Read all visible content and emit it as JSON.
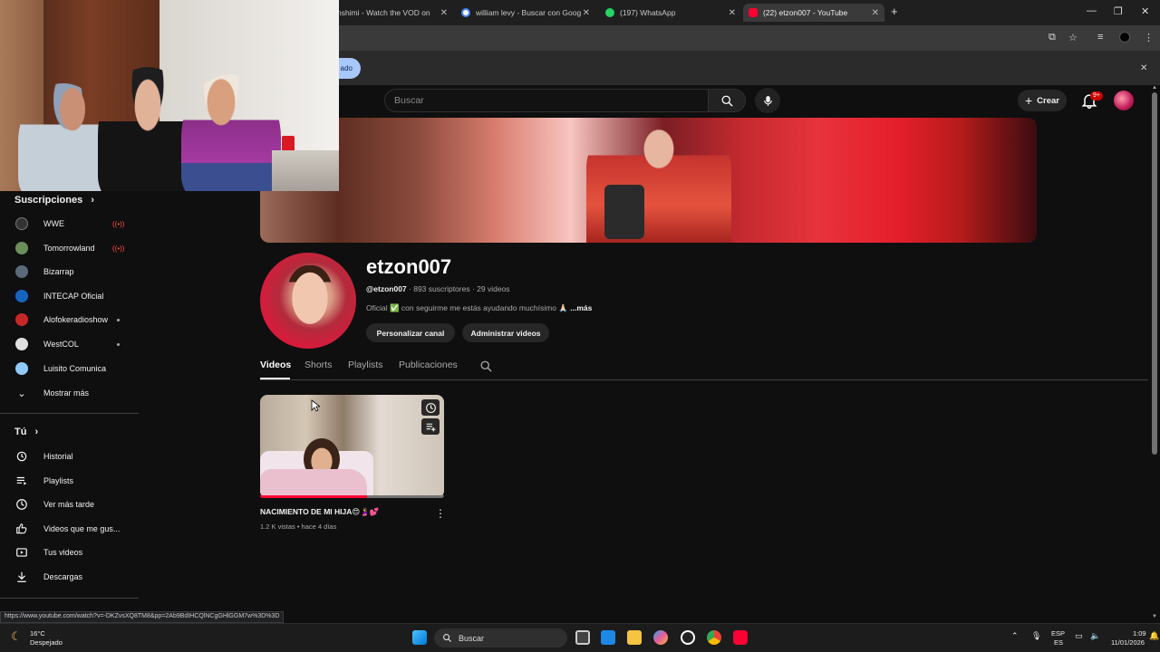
{
  "browser": {
    "tabs": [
      {
        "title": "nshimi - Watch the VOD on",
        "fav_color": "#ff7a00"
      },
      {
        "title": "william levy - Buscar con Goog",
        "fav_color": "#ffffff"
      },
      {
        "title": "(197) WhatsApp",
        "fav_color": "#25d366"
      },
      {
        "title": "(22) etzon007 - YouTube",
        "fav_color": "#ff0033"
      }
    ],
    "new_tab": "+",
    "infobar_partial": "ado",
    "close": "✕"
  },
  "header": {
    "search_placeholder": "Buscar",
    "create_label": "Crear",
    "notif_count": "9+"
  },
  "sidebar": {
    "subscriptions_title": "Suscripciones",
    "subscriptions": [
      {
        "label": "WWE",
        "status": "live",
        "color": "#333333"
      },
      {
        "label": "Tomorrowland",
        "status": "live",
        "color": "#6b8e5a"
      },
      {
        "label": "Bizarrap",
        "status": "",
        "color": "#5a6a7a"
      },
      {
        "label": "INTECAP Oficial",
        "status": "",
        "color": "#1565c0"
      },
      {
        "label": "Alofokeradioshow",
        "status": "dot",
        "color": "#c62828"
      },
      {
        "label": "WestCOL",
        "status": "dot",
        "color": "#e0e0e0"
      },
      {
        "label": "Luisito Comunica",
        "status": "",
        "color": "#90caf9"
      }
    ],
    "show_more": "Mostrar más",
    "you_title": "Tú",
    "you_items": [
      {
        "label": "Historial",
        "icon": "history-icon"
      },
      {
        "label": "Playlists",
        "icon": "playlists-icon"
      },
      {
        "label": "Ver más tarde",
        "icon": "watch-later-icon"
      },
      {
        "label": "Videos que me gus...",
        "icon": "like-icon"
      },
      {
        "label": "Tus videos",
        "icon": "your-videos-icon"
      },
      {
        "label": "Descargas",
        "icon": "download-icon"
      }
    ]
  },
  "channel": {
    "name": "etzon007",
    "handle": "@etzon007",
    "stats": " · 893 suscriptores · 29 videos",
    "desc": "Oficial ✅ con seguirme me estás ayudando muchísimo 🙏🏻",
    "more": " ...más",
    "customize_btn": "Personalizar canal",
    "manage_btn": "Administrar videos",
    "tabs": [
      "Videos",
      "Shorts",
      "Playlists",
      "Publicaciones"
    ]
  },
  "video": {
    "title": "NACIMIENTO DE MI HIJA😍🤰💕",
    "meta": "1.2 K vistas • hace 4 días",
    "watched_fraction": 0.58
  },
  "status_url": "https://www.youtube.com/watch?v=-DKZvsXQ8TM8&pp=2Ab9BdIHCQlNCgGHlGGM7w%3D%3D",
  "taskbar": {
    "weather_temp": "16°C",
    "weather_desc": "Despejado",
    "search_label": "Buscar",
    "lang_top": "ESP",
    "lang_bottom": "ES",
    "time": "1:09",
    "date": "11/01/2026"
  }
}
